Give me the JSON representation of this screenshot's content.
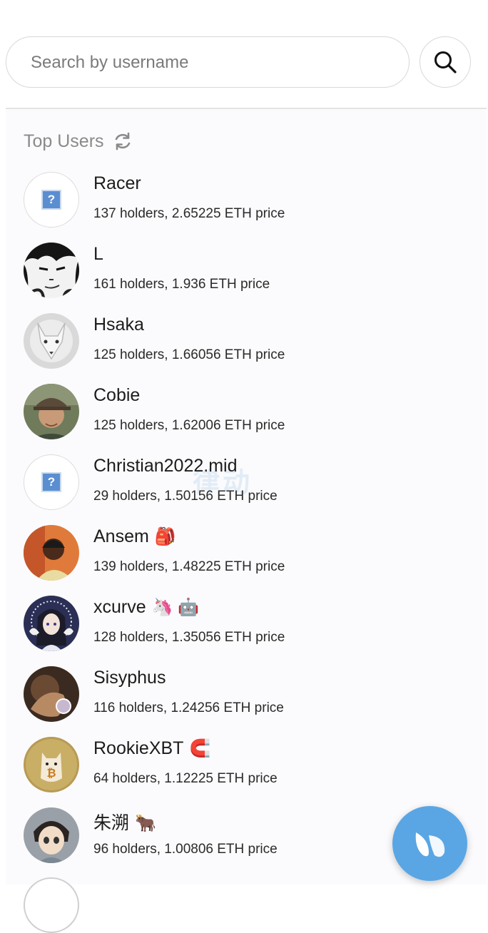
{
  "search": {
    "placeholder": "Search by username"
  },
  "section": {
    "title": "Top Users"
  },
  "users": [
    {
      "name": "Racer",
      "emoji": "",
      "holders_text": "137 holders, 2.65225 ETH price",
      "avatar": "placeholder"
    },
    {
      "name": "L",
      "emoji": "",
      "holders_text": "161 holders, 1.936 ETH price",
      "avatar": "sketch-face"
    },
    {
      "name": "Hsaka",
      "emoji": "",
      "holders_text": "125 holders, 1.66056 ETH price",
      "avatar": "white-wolf"
    },
    {
      "name": "Cobie",
      "emoji": "",
      "holders_text": "125 holders, 1.62006 ETH price",
      "avatar": "person-cap"
    },
    {
      "name": "Christian2022.mid",
      "emoji": "",
      "holders_text": "29 holders, 1.50156 ETH price",
      "avatar": "placeholder"
    },
    {
      "name": "Ansem",
      "emoji": "🎒",
      "holders_text": "139 holders, 1.48225 ETH price",
      "avatar": "person"
    },
    {
      "name": "xcurve",
      "emoji": "🦄 🤖",
      "holders_text": "128 holders, 1.35056 ETH price",
      "avatar": "anime-girl"
    },
    {
      "name": "Sisyphus",
      "emoji": "",
      "holders_text": "116 holders, 1.24256 ETH price",
      "avatar": "painting"
    },
    {
      "name": "RookieXBT",
      "emoji": "🧲",
      "holders_text": "64 holders, 1.12225 ETH price",
      "avatar": "bitcoin-cat"
    },
    {
      "name": "朱溯",
      "emoji": "🐂",
      "holders_text": "96 holders, 1.00806 ETH price",
      "avatar": "anime-boy"
    }
  ],
  "watermark": "律动",
  "colors": {
    "fab": "#5aa6e4",
    "placeholder_icon": "#5a8ed1"
  }
}
